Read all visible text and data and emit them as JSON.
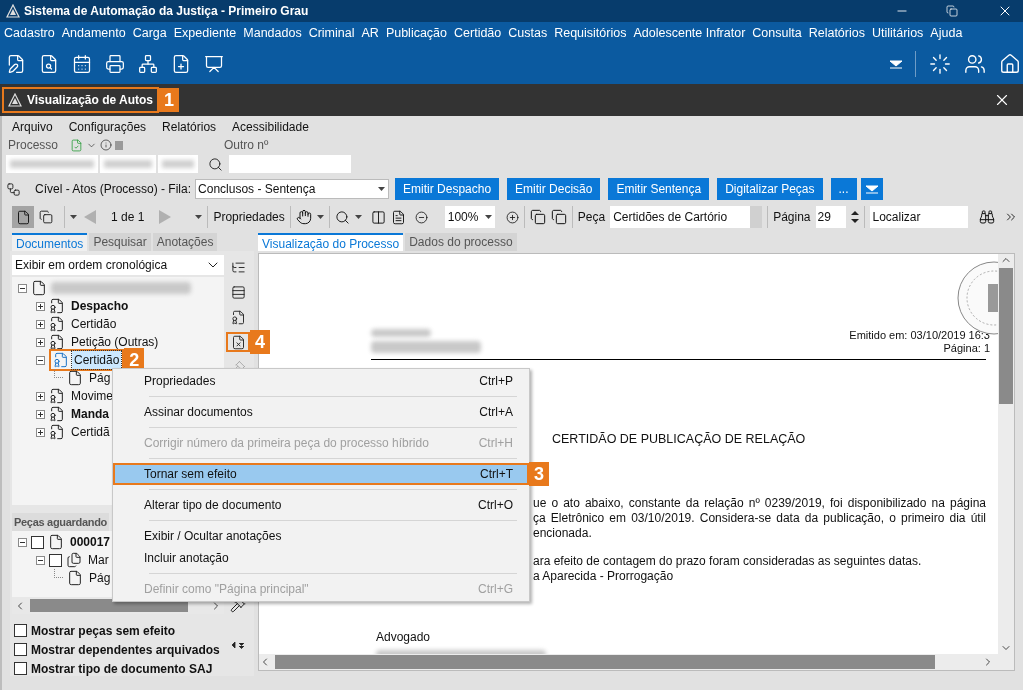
{
  "window": {
    "title": "Sistema de Automação da Justiça - Primeiro Grau"
  },
  "menu_bar": [
    "Cadastro",
    "Andamento",
    "Carga",
    "Expediente",
    "Mandados",
    "Criminal",
    "AR",
    "Publicação",
    "Certidão",
    "Custas",
    "Requisitórios",
    "Adolescente Infrator",
    "Consulta",
    "Relatórios",
    "Utilitários",
    "Ajuda"
  ],
  "screen_tab": {
    "label": "Visualização de Autos",
    "callout": "1"
  },
  "screen_menu": [
    "Arquivo",
    "Configurações",
    "Relatórios",
    "Acessibilidade"
  ],
  "process": {
    "label": "Processo",
    "other_label": "Outro nº"
  },
  "queue": {
    "label": "Cível - Atos (Processo) - Fila:",
    "value": "Conclusos - Sentença"
  },
  "action_buttons": [
    "Emitir Despacho",
    "Emitir Decisão",
    "Emitir Sentença",
    "Digitalizar Peças",
    "..."
  ],
  "viewer_toolbar": {
    "pages": "1 de 1",
    "properties": "Propriedades",
    "zoom": "100%",
    "piece_label": "Peça",
    "piece": "Certidões de Cartório",
    "page_label": "Página",
    "page": "29",
    "search": "Localizar"
  },
  "left_tabs": [
    {
      "label": "Documentos",
      "selected": true
    },
    {
      "label": "Pesquisar",
      "selected": false
    },
    {
      "label": "Anotações",
      "selected": false
    }
  ],
  "order": "Exibir em ordem cronológica",
  "documents_tree": {
    "kind": "page",
    "expanded": true,
    "children": [
      {
        "kind": "seal",
        "label": "Despacho",
        "bold": true,
        "expanded": false,
        "selected": false
      },
      {
        "kind": "seal",
        "label": "Certidão",
        "bold": false,
        "expanded": false,
        "selected": false
      },
      {
        "kind": "seal",
        "label": "Petição (Outras)",
        "bold": false,
        "expanded": false,
        "selected": false
      },
      {
        "kind": "seal",
        "label": "Certidão",
        "bold": false,
        "expanded": true,
        "selected": true,
        "callout": "2",
        "children": [
          {
            "kind": "page",
            "label": "Pág",
            "bold": false,
            "selected": false
          }
        ]
      },
      {
        "kind": "seal",
        "label": "Movime",
        "bold": false,
        "expanded": false,
        "selected": false
      },
      {
        "kind": "seal",
        "label": "Manda",
        "bold": true,
        "expanded": false,
        "selected": false
      },
      {
        "kind": "seal",
        "label": "Certidã",
        "bold": false,
        "expanded": false,
        "selected": false
      }
    ]
  },
  "side_tools": [
    {
      "kind": "tree",
      "disabled": false
    },
    {
      "kind": "rows",
      "disabled": false
    },
    {
      "kind": "seal",
      "disabled": false
    },
    {
      "kind": "void",
      "disabled": false,
      "callout": "4"
    },
    {
      "kind": "gavel",
      "disabled": true
    }
  ],
  "pending": {
    "title": "Peças aguardando",
    "items": [
      {
        "kind": "page",
        "label": "000017",
        "bold": true,
        "checked": false,
        "expanded": true,
        "children": [
          {
            "kind": "stack",
            "label": "Mar",
            "bold": false,
            "checked": false,
            "expanded": true,
            "children": [
              {
                "kind": "page",
                "label": "Pág",
                "bold": false
              }
            ]
          }
        ]
      }
    ]
  },
  "options": [
    {
      "label": "Mostrar peças sem efeito",
      "checked": false
    },
    {
      "label": "Mostrar dependentes arquivados",
      "checked": false
    },
    {
      "label": "Mostrar tipo de documento SAJ",
      "checked": false
    }
  ],
  "viewer_tabs": [
    {
      "label": "Visualização do Processo",
      "selected": true
    },
    {
      "label": "Dados do processo",
      "selected": false
    }
  ],
  "document": {
    "emitted": "Emitido em: 03/10/2019 16:3",
    "page": "Página: 1",
    "title": "CERTIDÃO DE PUBLICAÇÃO DE RELAÇÃO",
    "paragraph": [
      "ue o ato abaixo, constante da relação nº 0239/2019, foi disponibilizado na página",
      "ça Eletrônico em 03/10/2019. Considera-se data da publicação, o primeiro dia útil",
      "encionada."
    ],
    "dates": [
      "ara efeito de contagem do prazo foram consideradas as seguintes datas.",
      "a Aparecida - Prorrogação"
    ],
    "signer_label": "Advogado"
  },
  "context_menu": {
    "groups": [
      [
        {
          "label": "Propriedades",
          "shortcut": "Ctrl+P",
          "disabled": false,
          "selected": false
        }
      ],
      [
        {
          "label": "Assinar documentos",
          "shortcut": "Ctrl+A",
          "disabled": false,
          "selected": false
        }
      ],
      [
        {
          "label": "Corrigir número da primeira peça do processo híbrido",
          "shortcut": "Ctrl+H",
          "disabled": true,
          "selected": false
        }
      ],
      [
        {
          "label": "Tornar sem efeito",
          "shortcut": "Ctrl+T",
          "disabled": false,
          "selected": true,
          "callout": "3"
        }
      ],
      [
        {
          "label": "Alterar tipo de documento",
          "shortcut": "Ctrl+O",
          "disabled": false,
          "selected": false
        }
      ],
      [
        {
          "label": "Exibir / Ocultar anotações",
          "disabled": false,
          "selected": false
        },
        {
          "label": "Incluir anotação",
          "disabled": false,
          "selected": false
        }
      ],
      [
        {
          "label": "Definir como \"Página principal\"",
          "shortcut": "Ctrl+G",
          "disabled": true,
          "selected": false
        }
      ]
    ]
  }
}
